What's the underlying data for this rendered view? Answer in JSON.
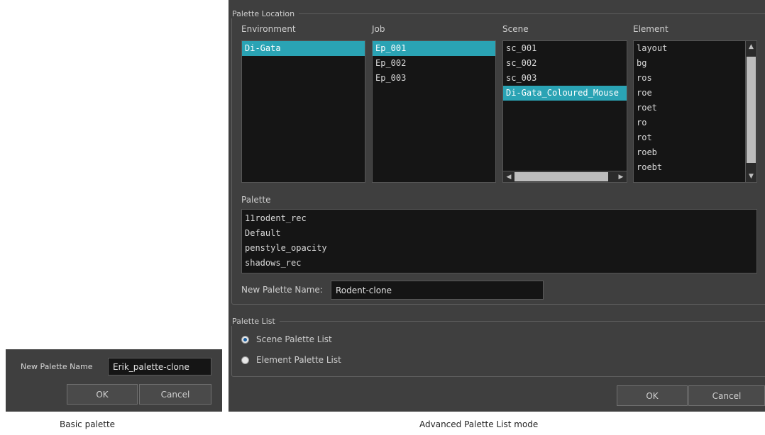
{
  "basic": {
    "new_name_label": "New Palette Name",
    "new_name_value": "Erik_palette-clone",
    "ok_label": "OK",
    "cancel_label": "Cancel",
    "caption": "Basic palette"
  },
  "advanced": {
    "location_title": "Palette Location",
    "columns": {
      "environment": {
        "label": "Environment",
        "items": [
          "Di-Gata"
        ],
        "selected": "Di-Gata"
      },
      "job": {
        "label": "Job",
        "items": [
          "Ep_001",
          "Ep_002",
          "Ep_003"
        ],
        "selected": "Ep_001"
      },
      "scene": {
        "label": "Scene",
        "items": [
          "sc_001",
          "sc_002",
          "sc_003",
          "Di-Gata_Coloured_Mouse"
        ],
        "selected": "Di-Gata_Coloured_Mouse"
      },
      "element": {
        "label": "Element",
        "items": [
          "layout",
          "bg",
          "ros",
          "roe",
          "roet",
          "ro",
          "rot",
          "roeb",
          "roebt"
        ]
      }
    },
    "palette": {
      "label": "Palette",
      "items": [
        "11rodent_rec",
        "Default",
        "penstyle_opacity",
        "shadows_rec"
      ]
    },
    "new_name_label": "New Palette Name:",
    "new_name_value": "Rodent-clone",
    "list_title": "Palette List",
    "scene_list_label": "Scene Palette List",
    "element_list_label": "Element Palette List",
    "scene_list_checked": true,
    "ok_label": "OK",
    "cancel_label": "Cancel",
    "caption": "Advanced Palette List mode"
  },
  "colors": {
    "dialog_bg": "#3f3f3f",
    "list_bg": "#151515",
    "selection": "#2aa3b4"
  }
}
